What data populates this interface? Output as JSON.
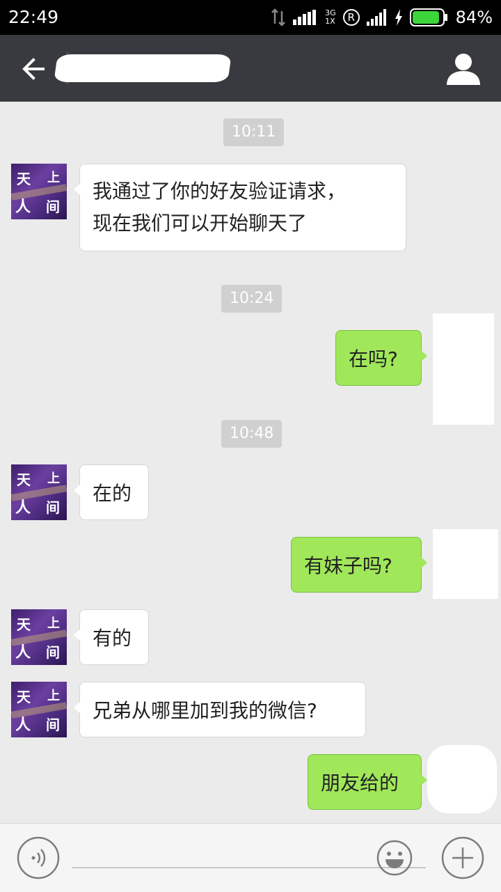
{
  "status_bar": {
    "time": "22:49",
    "network_top": "3G",
    "network_bottom": "1X",
    "roaming": "R",
    "battery": "84%"
  },
  "icons": {
    "back": "arrow-left-icon",
    "profile": "person-icon",
    "voice": "voice-icon",
    "emoji": "emoji-icon",
    "plus": "plus-icon"
  },
  "contact_avatar": {
    "chars": [
      "天",
      "上",
      "人",
      "间"
    ]
  },
  "messages": [
    {
      "type": "timestamp",
      "text": "10:11"
    },
    {
      "type": "incoming",
      "lines": [
        "我通过了你的好友验证请求，",
        "现在我们可以开始聊天了"
      ]
    },
    {
      "type": "timestamp",
      "text": "10:24"
    },
    {
      "type": "outgoing",
      "text": "在吗?"
    },
    {
      "type": "timestamp",
      "text": "10:48"
    },
    {
      "type": "incoming",
      "text": "在的"
    },
    {
      "type": "outgoing",
      "text": "有妹子吗?"
    },
    {
      "type": "incoming",
      "text": "有的"
    },
    {
      "type": "incoming",
      "text": "兄弟从哪里加到我的微信?"
    },
    {
      "type": "outgoing",
      "text": "朋友给的"
    }
  ],
  "colors": {
    "outgoing_bubble": "#a0e75a",
    "incoming_bubble": "#ffffff",
    "title_bar": "#393a3f",
    "chat_bg": "#ebebeb"
  }
}
